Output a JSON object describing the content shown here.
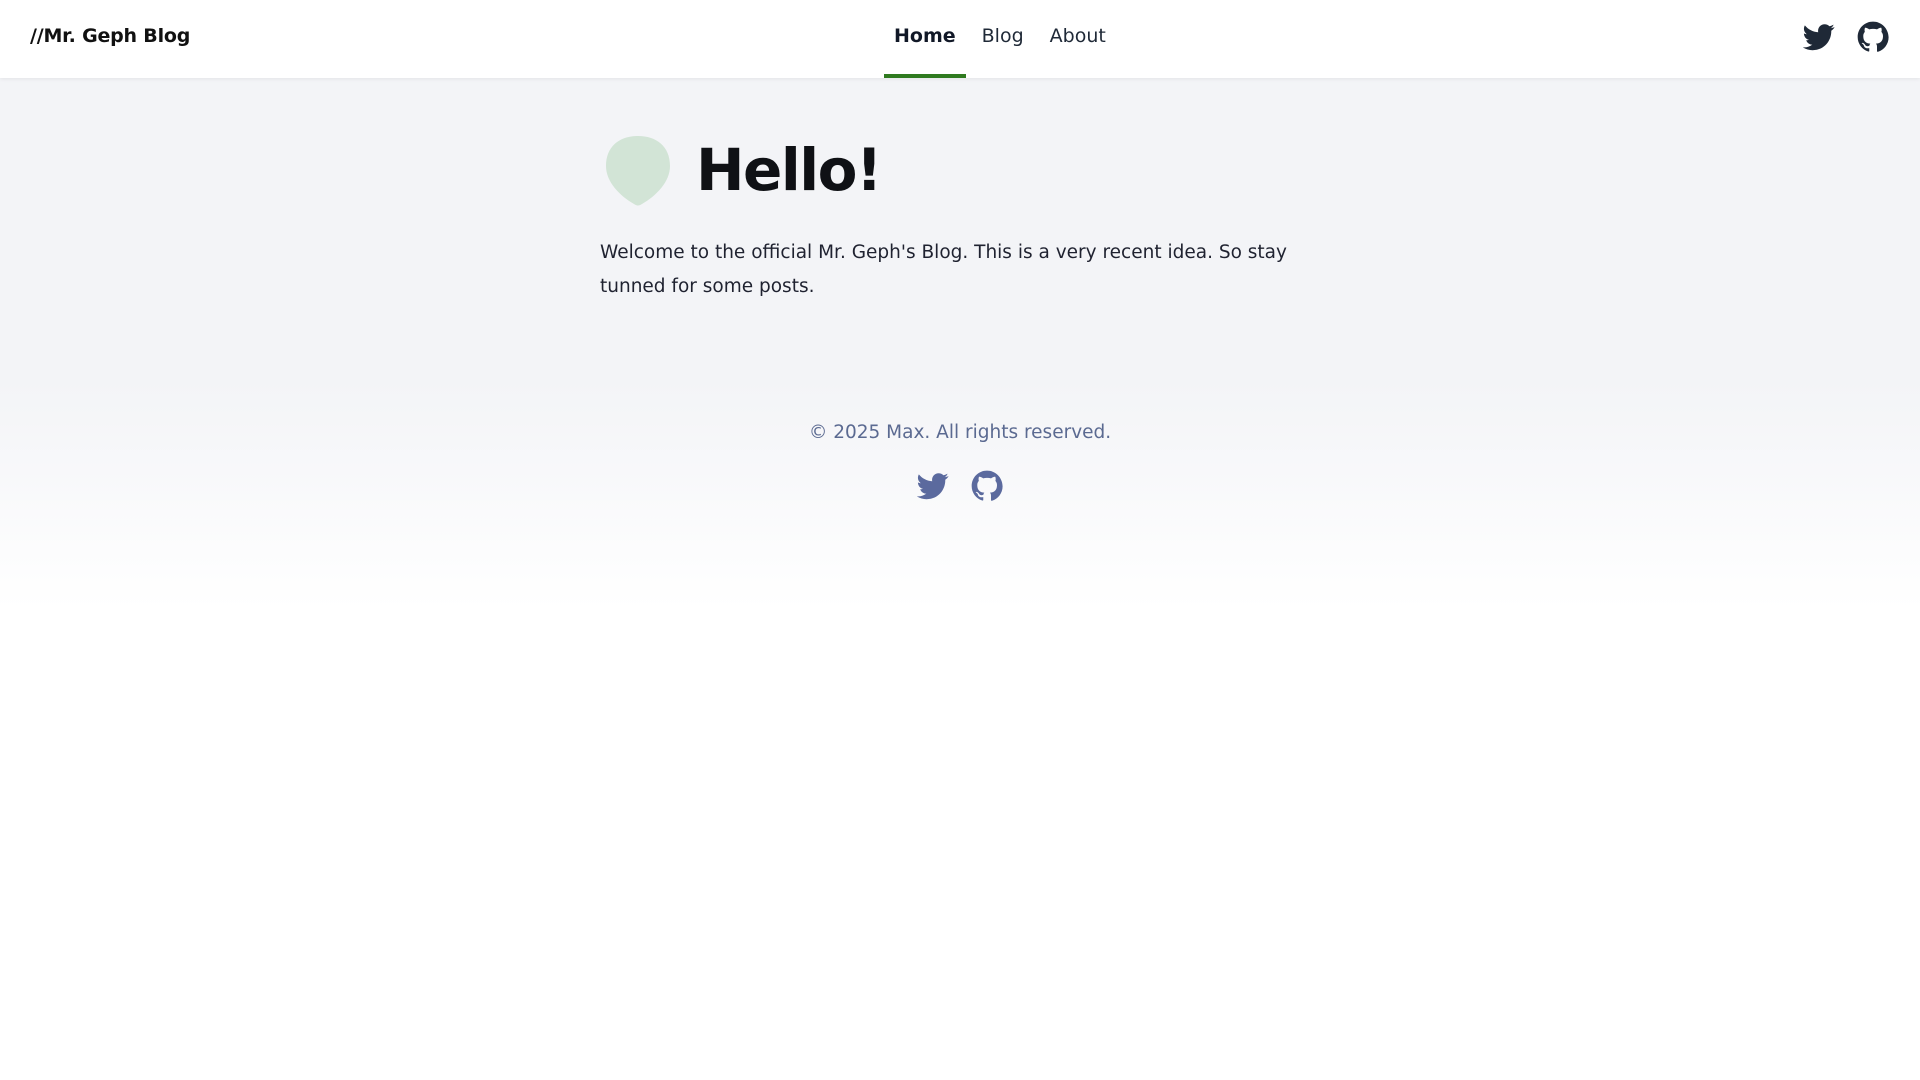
{
  "header": {
    "brand": "//Mr. Geph Blog",
    "nav": [
      {
        "label": "Home",
        "active": true
      },
      {
        "label": "Blog",
        "active": false
      },
      {
        "label": "About",
        "active": false
      }
    ],
    "icons": [
      "twitter-icon",
      "github-icon"
    ],
    "icon_color": "#1f2937",
    "accent_color": "#2f7a1f"
  },
  "main": {
    "title": "Hello!",
    "intro": "Welcome to the official Mr. Geph's Blog. This is a very recent idea. So stay tunned for some posts.",
    "blob_color": "#d2e4d6"
  },
  "footer": {
    "copyright": "© 2025 Max. All rights reserved.",
    "icons": [
      "twitter-icon",
      "github-icon"
    ],
    "icon_color": "#5b6a9e"
  }
}
